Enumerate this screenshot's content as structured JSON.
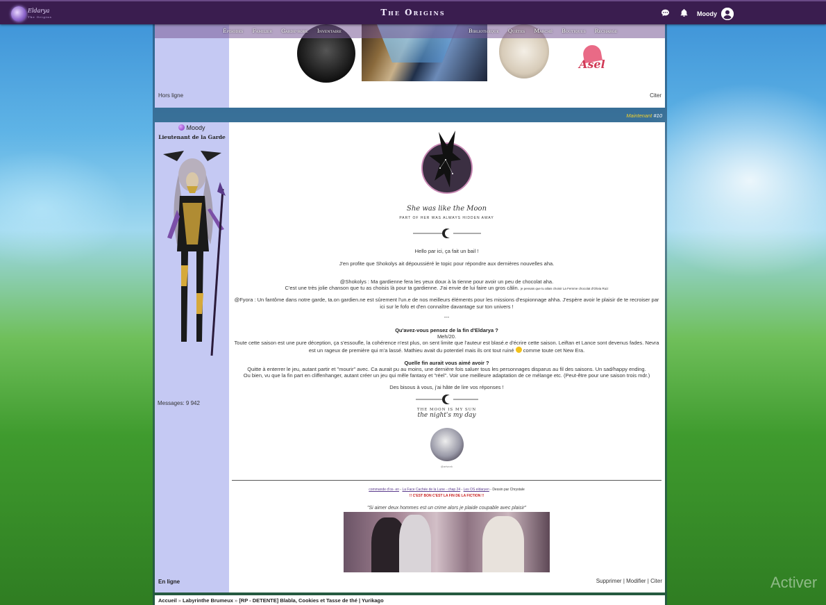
{
  "header": {
    "site_title": "The Origins",
    "logo_text": "Eldarya",
    "logo_sub": "The Origins",
    "user_name": "Moody"
  },
  "nav": {
    "left": [
      "Épisodes",
      "Familier",
      "Garde-robe",
      "Inventaire"
    ],
    "right": [
      "Bibliothèque",
      "Quêtes",
      "Marché",
      "Boutiques",
      "Recharge"
    ]
  },
  "post_prev": {
    "status": "Hors ligne",
    "cite": "Citer",
    "sig_word": "Asel"
  },
  "separator": {
    "time": "Maintenant",
    "number": "#10"
  },
  "post": {
    "author": "Moody",
    "rank": "Lieutenant de la Garde",
    "messages": "Messages: 9 942",
    "status": "En ligne",
    "actions": [
      "Supprimer",
      "Modifier",
      "Citer"
    ],
    "action_sep": " | ",
    "banner_line1": "She was like the Moon",
    "banner_line2": "part of her was always hidden away",
    "greeting": "Hello par ici, ça fait un bail !",
    "intro": "J'en profite que Shokolys ait dépoussiéré le topic pour répondre aux dernières nouvelles aha.",
    "reply1_a": "@Shokolys : Ma gardienne fera les yeux doux à la tienne pour avoir un peu de chocolat aha.",
    "reply1_b": "C'est une très jolie chanson que tu as choisis là pour ta gardienne. J'ai envie de lui faire un gros câlin.",
    "reply1_small": "je pensais que tu allais choisir La Femme chocolat d'Olivia Ruiz",
    "reply2": "@Fyora : Un fantôme dans notre garde, ta.on gardien.ne est sûrement l'un.e de nos meilleurs éléments pour les missions d'espionnage ahha. J'espère avoir le plaisir de te recroiser par ici sur le fofo et d'en connaître davantage sur ton univers !",
    "dashes": "---",
    "q1": "Qu'avez-vous pensez de la fin d'Eldarya ?",
    "q1_ans": "Meh/20.",
    "q1_text": "Toute cette saison est une pure déception, ça s'essoufle, la cohérence n'est plus, on sent limite que l'auteur est blasé.e d'écrire cette saison. Leiftan et Lance sont devenus fades. Nevra est un rageux de première qui m'a lassé. Mathieu avait du potentiel mais ils ont tout ruiné",
    "q1_tail": "comme toute cet New Era.",
    "q2": "Quelle fin aurait vous aimé avoir ?",
    "q2_text1": "Quitte à enterrer le jeu, autant partir et \"mourir\" avec. Ca aurait pu au moins, une dernière fois saluer tous les personnages disparus au fil des saisons. Un sad/happy ending.",
    "q2_text2": "Ou bien, vu que la fin part en cliffenhanger, autant créer un jeu qui mêle fantasy et \"réel\". Voir une meilleure adaptation de ce mélange etc. (Peut-être pour une saison trois mdr.)",
    "bye": "Des bisous à vous, j'ai hâte de lire vos réponses !",
    "moon_line1": "The Moon is my sun",
    "moon_line2": "the night's my day",
    "tiny_credit": "@artwork",
    "links": [
      "commande d'ox- en",
      "La Face Cachée de la Lune - chap 24",
      "Les OS eldaryen"
    ],
    "link_sep": " - ",
    "drawing_credit": "Dessin par Chrystale",
    "end_notice": "!! C'EST BON C'EST LA FIN DE LA FICTION !!",
    "quote": "\"Si aimer deux hommes est un crime alors je plaide coupable avec plaisir\""
  },
  "breadcrumb": {
    "items": [
      "Accueil",
      "Labyrinthe Brumeux",
      "[RP - DETENTE] Blabla, Cookies et Tasse de thé | Yurikago"
    ],
    "sep": " » "
  },
  "watermark": "Activer",
  "colors": {
    "topbar": "#3a1d4f",
    "sidebar": "#c5c9f3",
    "accent_yellow": "#f2d02c",
    "alert_red": "#c81e1e"
  }
}
